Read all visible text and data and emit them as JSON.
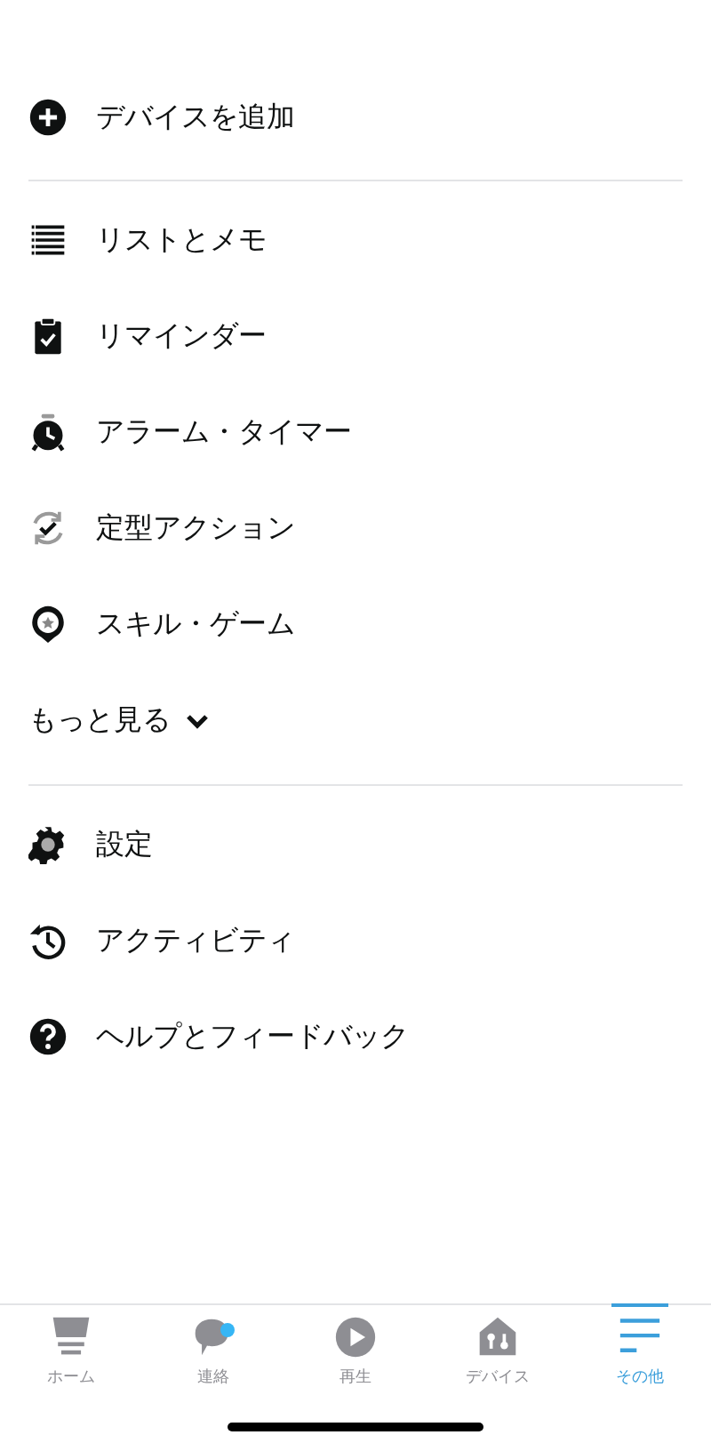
{
  "menu_sections": [
    {
      "items": [
        {
          "kind": "plus",
          "label": "デバイスを追加"
        }
      ]
    },
    {
      "items": [
        {
          "kind": "list",
          "label": "リストとメモ"
        },
        {
          "kind": "clipboard",
          "label": "リマインダー"
        },
        {
          "kind": "alarm",
          "label": "アラーム・タイマー"
        },
        {
          "kind": "routine",
          "label": "定型アクション"
        },
        {
          "kind": "skill",
          "label": "スキル・ゲーム"
        }
      ],
      "more": {
        "label": "もっと見る",
        "expanded": false
      }
    },
    {
      "items": [
        {
          "kind": "gear",
          "label": "設定"
        },
        {
          "kind": "history",
          "label": "アクティビティ"
        },
        {
          "kind": "help",
          "label": "ヘルプとフィードバック"
        }
      ]
    }
  ],
  "tab_bar": [
    {
      "kind": "home",
      "label": "ホーム",
      "selected": false,
      "badge": false
    },
    {
      "kind": "chat",
      "label": "連絡",
      "selected": false,
      "badge": true
    },
    {
      "kind": "play",
      "label": "再生",
      "selected": false,
      "badge": false
    },
    {
      "kind": "devices",
      "label": "デバイス",
      "selected": false,
      "badge": false
    },
    {
      "kind": "more",
      "label": "その他",
      "selected": true,
      "badge": false
    }
  ]
}
